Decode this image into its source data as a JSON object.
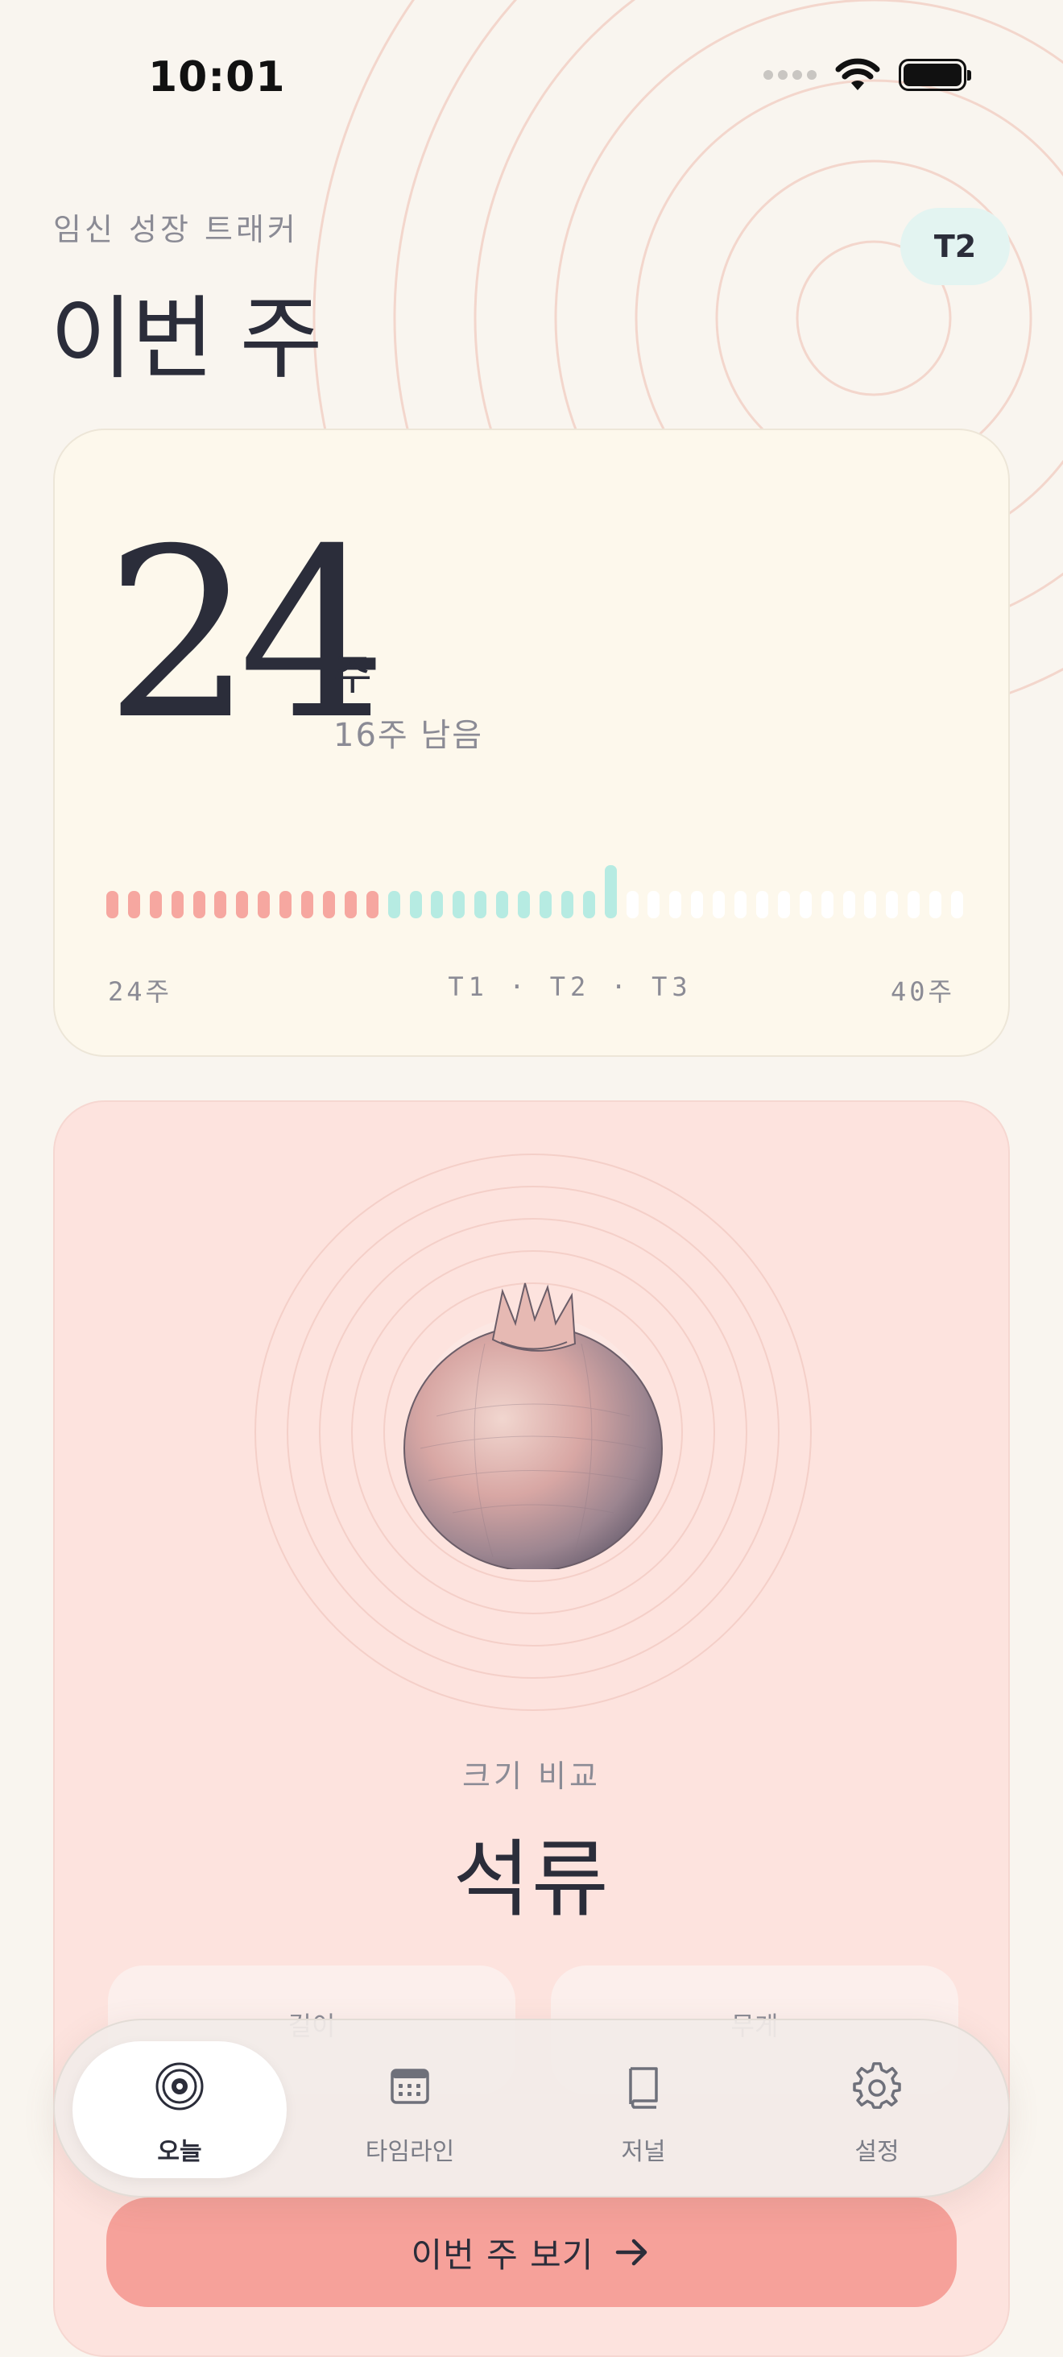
{
  "status_bar": {
    "time": "10:01"
  },
  "header": {
    "eyebrow": "임신 성장 트래커",
    "title": "이번 주",
    "trimester_badge": "T2"
  },
  "week_card": {
    "week": "24",
    "unit": "주",
    "weeks_left": "16주 남음",
    "current_week": 24,
    "total_weeks": 40,
    "scale_start": "24주",
    "scale_trimesters": "T1 · T2 · T3",
    "scale_end": "40주",
    "colors": {
      "t1": "#f6a7a0",
      "t2": "#b6ebe2",
      "future": "#ffffff"
    }
  },
  "fruit_card": {
    "illustration": "pomegranate",
    "compare_label": "크기 비교",
    "fruit_name": "석류",
    "metrics": [
      {
        "label": "길이"
      },
      {
        "label": "무게"
      }
    ]
  },
  "bottom_nav": {
    "items": [
      {
        "label": "오늘",
        "icon": "target-icon",
        "active": true
      },
      {
        "label": "타임라인",
        "icon": "calendar-icon",
        "active": false
      },
      {
        "label": "저널",
        "icon": "book-icon",
        "active": false
      },
      {
        "label": "설정",
        "icon": "gear-icon",
        "active": false
      }
    ]
  },
  "cta": {
    "label": "이번 주 보기",
    "icon": "arrow-right-icon"
  },
  "colors": {
    "background": "#f9f5ef",
    "accent": "#f6a19a",
    "mint": "#e3f4f1"
  }
}
